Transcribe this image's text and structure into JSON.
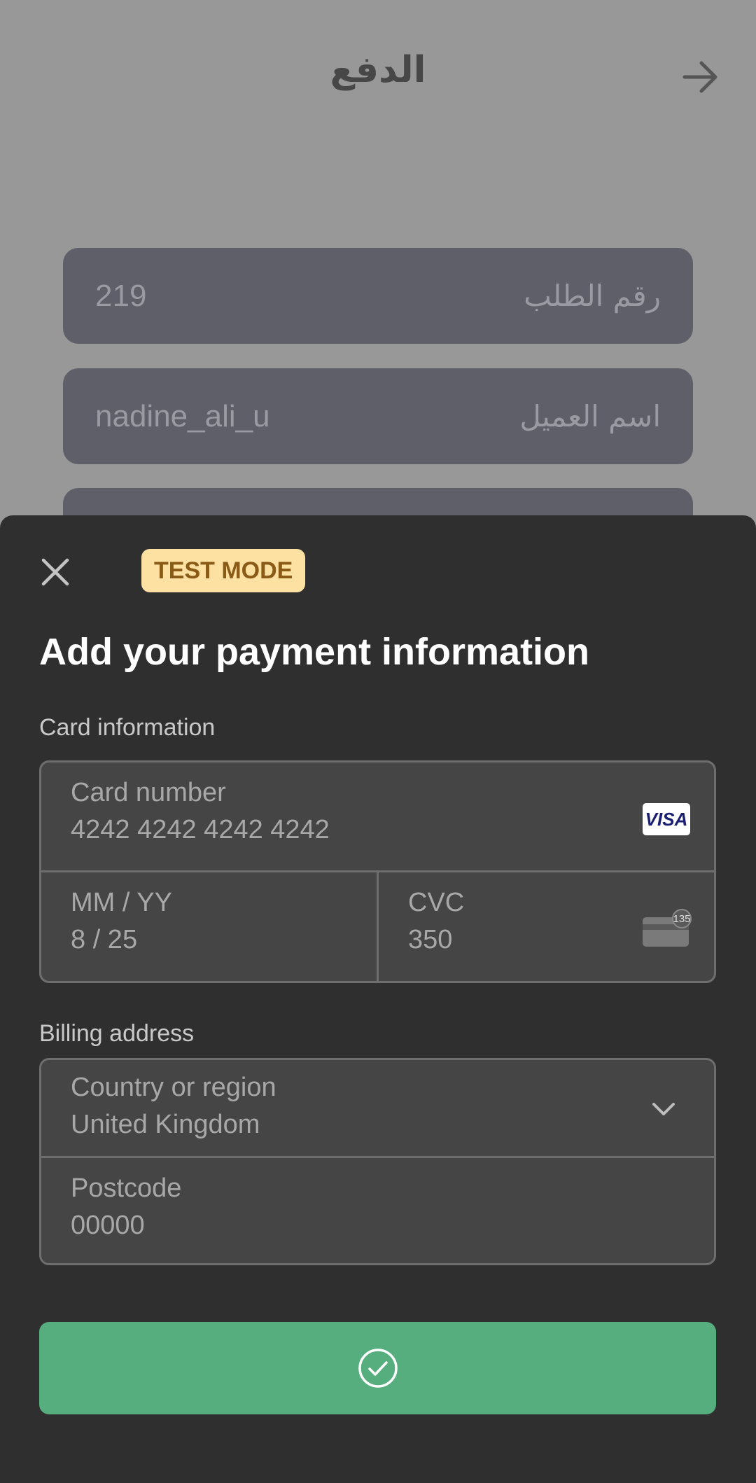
{
  "background": {
    "title": "الدفع",
    "fields": [
      {
        "label": "رقم الطلب",
        "value": "219"
      },
      {
        "label": "اسم العميل",
        "value": "nadine_ali_u"
      }
    ]
  },
  "sheet": {
    "badge": "TEST MODE",
    "title": "Add your payment information",
    "card_section_label": "Card information",
    "card_number": {
      "label": "Card number",
      "value": "4242 4242 4242 4242",
      "brand": "VISA"
    },
    "expiry": {
      "label": "MM / YY",
      "value": "8 / 25"
    },
    "cvc": {
      "label": "CVC",
      "value": "350",
      "icon_text": "135"
    },
    "billing_section_label": "Billing address",
    "country": {
      "label": "Country or region",
      "value": "United Kingdom"
    },
    "postcode": {
      "label": "Postcode",
      "value": "00000"
    }
  },
  "colors": {
    "submit": "#56ae7e",
    "badge_bg": "#fde1a3",
    "badge_text": "#8a5a17",
    "sheet_bg": "#2f2f2f"
  }
}
